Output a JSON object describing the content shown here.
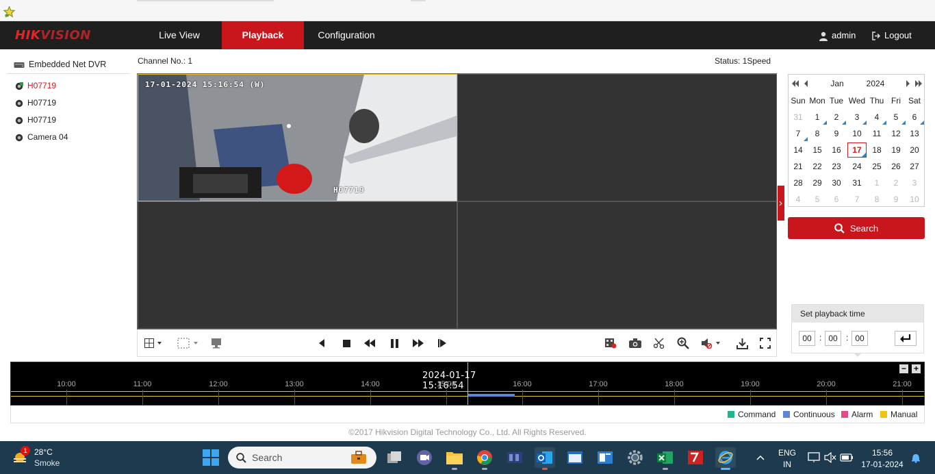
{
  "header": {
    "logo": {
      "part1": "HIK",
      "part2": "VISION"
    },
    "nav": [
      "Live View",
      "Playback",
      "Configuration"
    ],
    "user": "admin",
    "logout": "Logout"
  },
  "tree": {
    "root": "Embedded Net DVR",
    "cameras": [
      "H07719",
      "H07719",
      "H07719",
      "Camera 04"
    ]
  },
  "channel_label": "Channel No.: 1",
  "status_label": "Status: 1Speed",
  "video": {
    "osd_time": "17-01-2024 15:16:54 (W)",
    "osd_name": "H07719"
  },
  "calendar": {
    "month": "Jan",
    "year": "2024",
    "days_of_week": [
      "Sun",
      "Mon",
      "Tue",
      "Wed",
      "Thu",
      "Fri",
      "Sat"
    ],
    "weeks": [
      [
        "31",
        "1",
        "2",
        "3",
        "4",
        "5",
        "6"
      ],
      [
        "7",
        "8",
        "9",
        "10",
        "11",
        "12",
        "13"
      ],
      [
        "14",
        "15",
        "16",
        "17",
        "18",
        "19",
        "20"
      ],
      [
        "21",
        "22",
        "23",
        "24",
        "25",
        "26",
        "27"
      ],
      [
        "28",
        "29",
        "30",
        "31",
        "1",
        "2",
        "3"
      ],
      [
        "4",
        "5",
        "6",
        "7",
        "8",
        "9",
        "10"
      ]
    ],
    "selected_day": "17",
    "recorded_days": [
      "1",
      "2",
      "3",
      "4",
      "5",
      "6",
      "7",
      "17"
    ]
  },
  "search_label": "Search",
  "playback_time": {
    "title": "Set playback time",
    "hh": "00",
    "mm": "00",
    "ss": "00",
    "sep": ":"
  },
  "timeline": {
    "current": "2024-01-17 15:16:54",
    "hours": [
      "10:00",
      "11:00",
      "12:00",
      "13:00",
      "14:00",
      "15:00",
      "16:00",
      "17:00",
      "18:00",
      "19:00",
      "20:00",
      "21:00"
    ],
    "zoom_out": "−",
    "zoom_in": "+"
  },
  "legend": [
    {
      "label": "Command",
      "color": "#1fb592"
    },
    {
      "label": "Continuous",
      "color": "#5b87d4"
    },
    {
      "label": "Alarm",
      "color": "#e44a86"
    },
    {
      "label": "Manual",
      "color": "#f2c40f"
    }
  ],
  "footer": "©2017 Hikvision Digital Technology Co., Ltd. All Rights Reserved.",
  "taskbar": {
    "weather_temp": "28°C",
    "weather_cond": "Smoke",
    "badge": "1",
    "search_placeholder": "Search",
    "lang1": "ENG",
    "lang2": "IN",
    "time": "15:56",
    "date": "17-01-2024"
  },
  "colors": {
    "brand_red": "#c9161d",
    "header_bg": "#1f1f1f",
    "selection_yellow": "#e6c22a",
    "taskbar_bg": "#1d3a4e"
  }
}
